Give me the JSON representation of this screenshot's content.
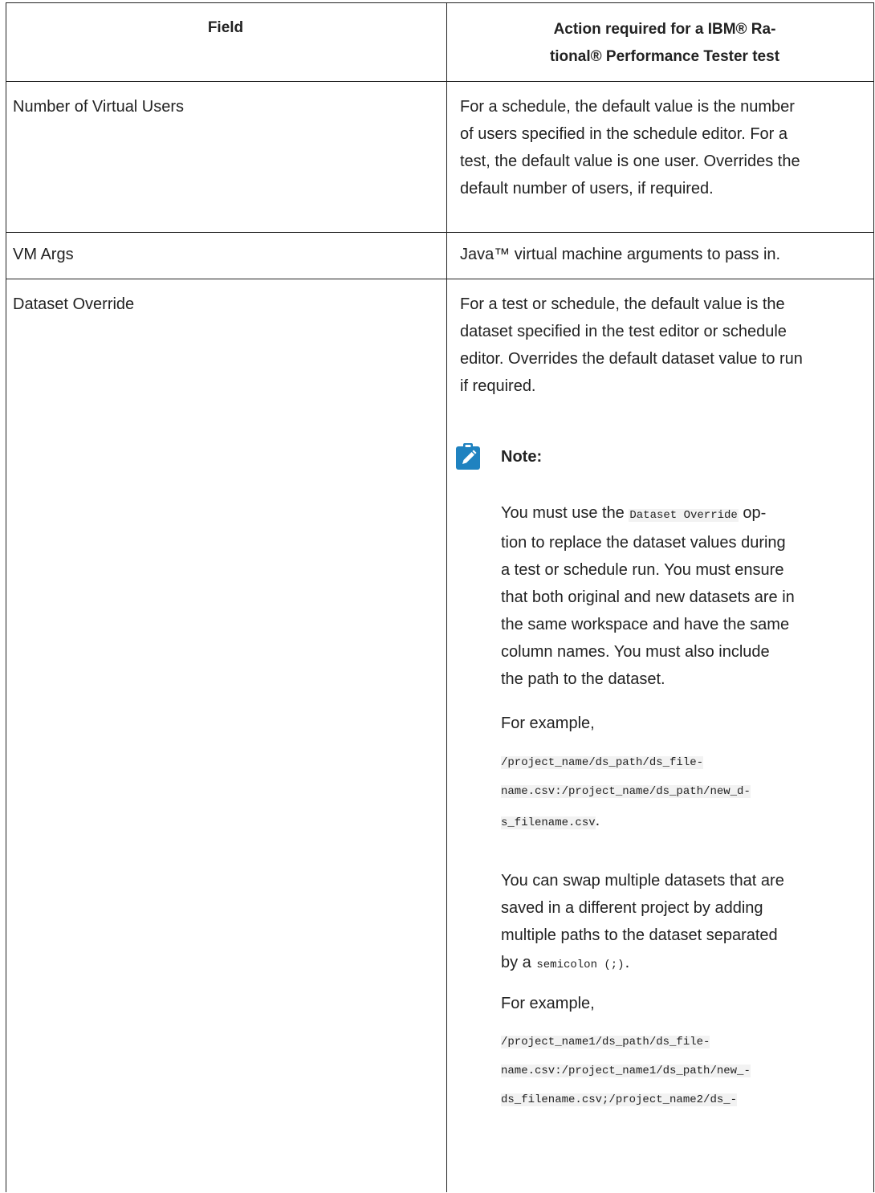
{
  "table": {
    "headers": {
      "field": "Field",
      "action_line1": "Action required for a IBM® Ra-",
      "action_line2": "tional® Performance Tester test"
    },
    "rows": [
      {
        "field": "Number of Virtual Users",
        "action_lines": [
          "For a schedule, the default value is the number",
          "of users specified in the schedule editor. For a",
          "test, the default value is one user. Overrides the",
          "default number of users, if required."
        ]
      },
      {
        "field": "VM Args",
        "action_lines": [
          "Java™ virtual machine arguments to pass in."
        ]
      },
      {
        "field": "Dataset Override",
        "action_lines": [
          "For a test or schedule, the default value is the",
          "dataset specified in the test editor or schedule",
          "editor. Overrides the default dataset value to run",
          "if required."
        ]
      }
    ]
  },
  "note": {
    "icon": "pencil-note-icon",
    "title": "Note:",
    "para1": {
      "line1_pre": "You must use the ",
      "line1_code": "Dataset Override",
      "line1_post": " op-",
      "lines": [
        "tion to replace the dataset values during",
        "a test or schedule run. You must ensure",
        "that both original and new datasets are in",
        "the same workspace and have the same",
        "column names. You must also include",
        "the path to the dataset."
      ]
    },
    "example1_label": "For example,",
    "example1_code": [
      "/project_name/ds_path/ds_file-",
      "name.csv:/project_name/ds_path/new_d-",
      "s_filename.csv"
    ],
    "example1_suffix": ".",
    "para2": {
      "lines": [
        "You can swap multiple datasets that are",
        "saved in a different project by adding",
        "multiple paths to the dataset separated"
      ],
      "last_pre": "by a ",
      "last_code": "semicolon (;)",
      "last_post": "."
    },
    "example2_label": "For example,",
    "example2_code": [
      "/project_name1/ds_path/ds_file-",
      "name.csv:/project_name1/ds_path/new_-",
      "ds_filename.csv;/project_name2/ds_-"
    ]
  },
  "colors": {
    "border": "#222222",
    "note_icon": "#1f82c0",
    "code_bg": "#f2f2f2"
  }
}
